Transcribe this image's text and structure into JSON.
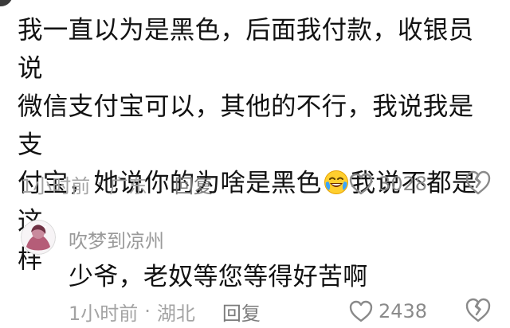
{
  "main_comment": {
    "lines": [
      "我一直以为是黑色，后面我付款，收银员说",
      "微信支付宝可以，其他的不行，我说我是支",
      "付宝，她说你的为啥是黑色",
      "样"
    ],
    "line3_suffix": "我说不都是这",
    "emoji": "laughing-crying-emoji",
    "time": "1小时前",
    "separator": "·",
    "location": "广东",
    "reply_label": "回复",
    "likes": "3028"
  },
  "reply_comment": {
    "username": "吹梦到凉州",
    "text": "少爷，老奴等您等得好苦啊",
    "time": "1小时前",
    "separator": "·",
    "location": "湖北",
    "reply_label": "回复",
    "likes": "2438"
  },
  "colors": {
    "text": "#121212",
    "meta": "#a3a3a3",
    "reply_link": "#7b7b7b",
    "icon": "#8a8a8a"
  }
}
